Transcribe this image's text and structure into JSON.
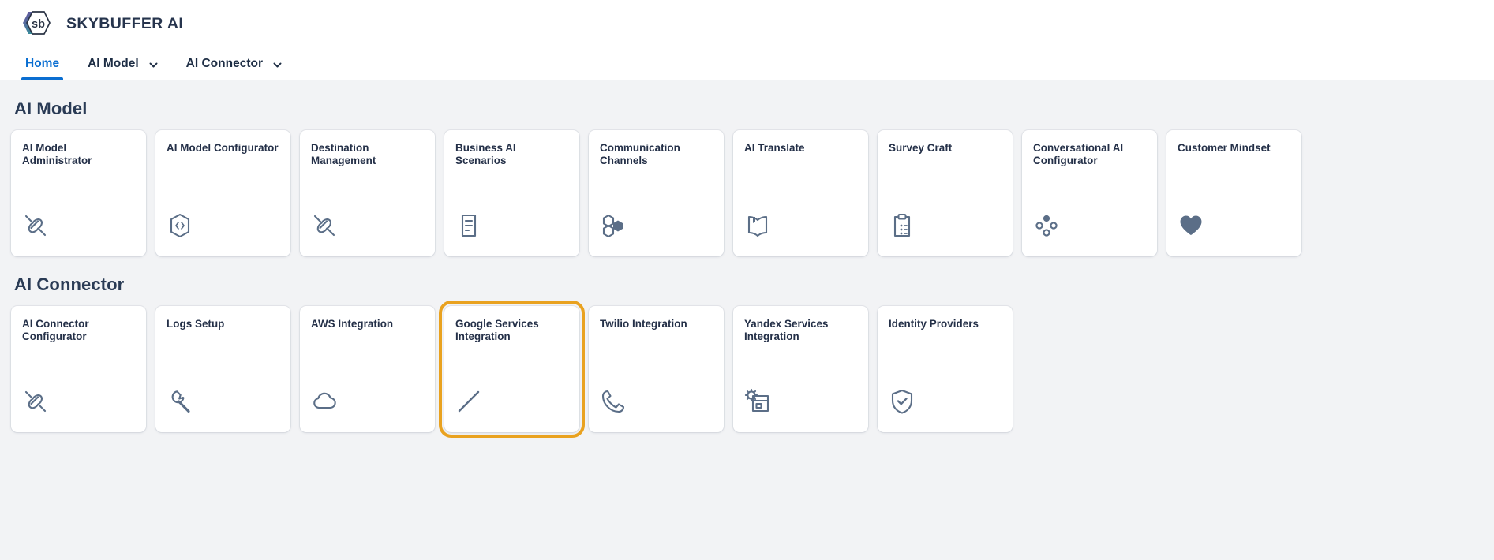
{
  "brand": {
    "logo_text": "sb",
    "title": "SKYBUFFER AI",
    "logo_colors": {
      "purple": "#6b4e9e",
      "teal": "#1fae9b"
    }
  },
  "nav": {
    "tabs": [
      {
        "label": "Home",
        "active": true,
        "has_dropdown": false
      },
      {
        "label": "AI Model",
        "active": false,
        "has_dropdown": true
      },
      {
        "label": "AI Connector",
        "active": false,
        "has_dropdown": true
      }
    ],
    "active_color": "#0a6ed1"
  },
  "theme": {
    "background": "#f2f3f5",
    "tile_background": "#ffffff",
    "text": "#243048",
    "icon": "#5b6e87",
    "selection_highlight": "#e9a220"
  },
  "groups": [
    {
      "title": "AI Model",
      "tiles": [
        {
          "title": "AI Model Administrator",
          "icon": "connector-plug-icon",
          "selected": false
        },
        {
          "title": "AI Model Configurator",
          "icon": "code-hexagon-icon",
          "selected": false
        },
        {
          "title": "Destination Management",
          "icon": "connector-plug-icon",
          "selected": false
        },
        {
          "title": "Business AI Scenarios",
          "icon": "document-lines-icon",
          "selected": false
        },
        {
          "title": "Communication Channels",
          "icon": "hexagon-group-icon",
          "selected": false
        },
        {
          "title": "AI Translate",
          "icon": "open-book-icon",
          "selected": false
        },
        {
          "title": "Survey Craft",
          "icon": "clipboard-list-icon",
          "selected": false
        },
        {
          "title": "Conversational AI Configurator",
          "icon": "dots-cluster-icon",
          "selected": false
        },
        {
          "title": "Customer Mindset",
          "icon": "heart-icon",
          "selected": false
        }
      ]
    },
    {
      "title": "AI Connector",
      "tiles": [
        {
          "title": "AI Connector Configurator",
          "icon": "connector-plug-icon",
          "selected": false
        },
        {
          "title": "Logs Setup",
          "icon": "wrench-icon",
          "selected": false
        },
        {
          "title": "AWS Integration",
          "icon": "cloud-icon",
          "selected": false
        },
        {
          "title": "Google Services Integration",
          "icon": "diagonal-line-icon",
          "selected": true
        },
        {
          "title": "Twilio Integration",
          "icon": "phone-icon",
          "selected": false
        },
        {
          "title": "Yandex Services Integration",
          "icon": "window-gear-icon",
          "selected": false
        },
        {
          "title": "Identity Providers",
          "icon": "shield-check-icon",
          "selected": false
        }
      ]
    }
  ]
}
